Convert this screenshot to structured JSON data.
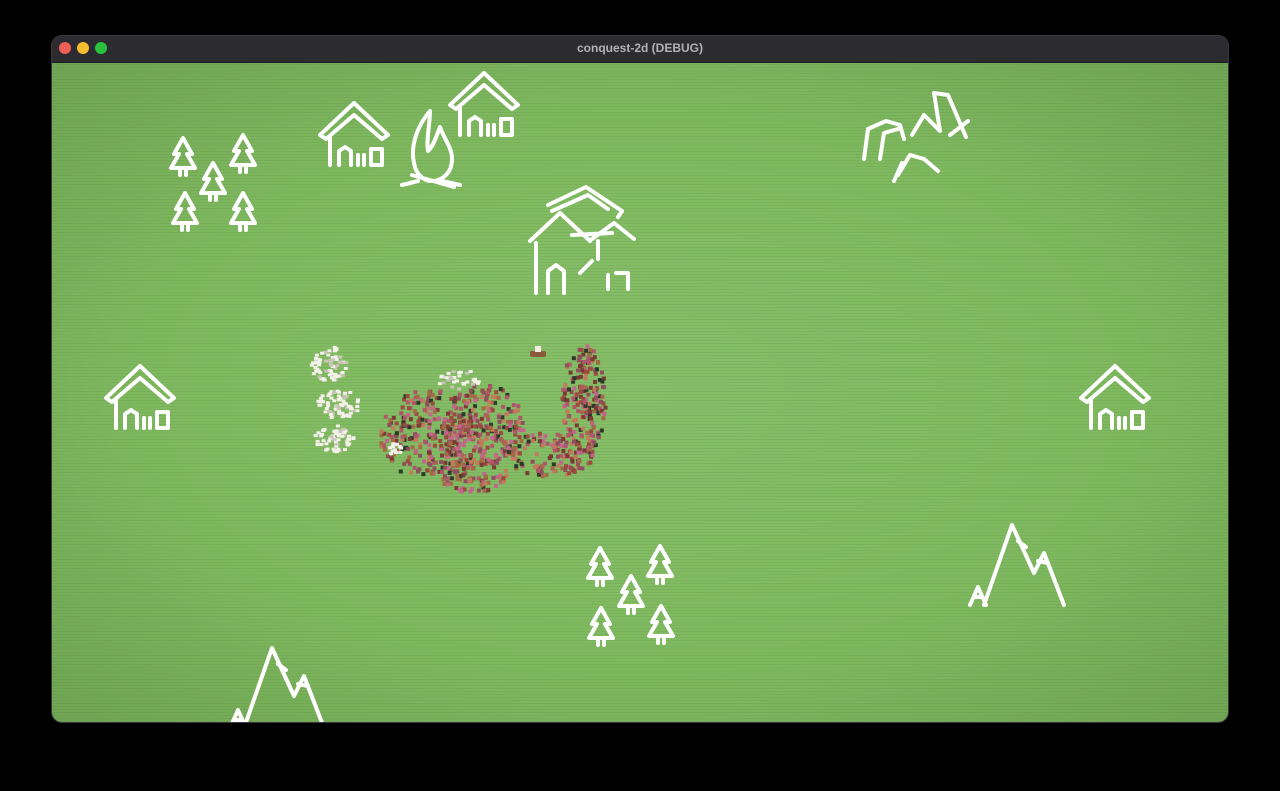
{
  "window": {
    "title": "conquest-2d (DEBUG)"
  },
  "map": {
    "background_color": "#7fb95f",
    "sprite_color": "#ffffff",
    "objects": [
      {
        "kind": "forest"
      },
      {
        "kind": "house"
      },
      {
        "kind": "campfire"
      },
      {
        "kind": "house"
      },
      {
        "kind": "village"
      },
      {
        "kind": "hills"
      },
      {
        "kind": "house"
      },
      {
        "kind": "house"
      },
      {
        "kind": "mountains"
      },
      {
        "kind": "forest"
      },
      {
        "kind": "mountains"
      },
      {
        "kind": "battle-army"
      },
      {
        "kind": "unit"
      }
    ]
  }
}
